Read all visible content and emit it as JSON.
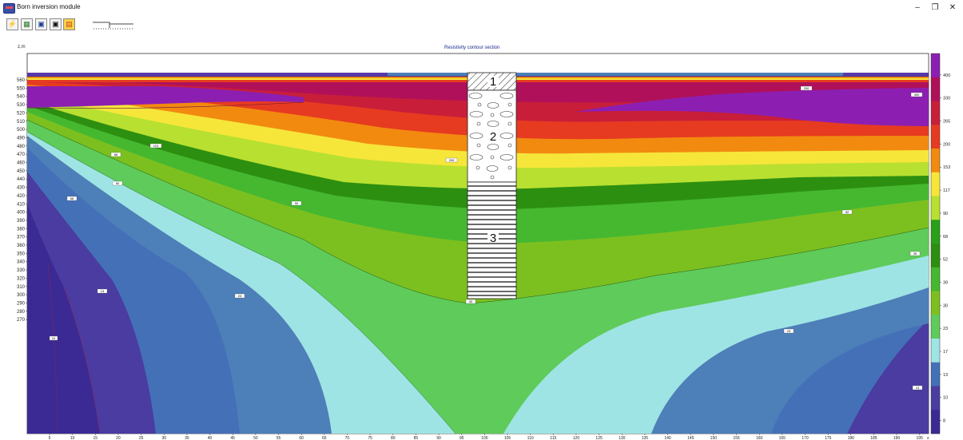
{
  "window": {
    "title": "Born inversion module",
    "icon": "app-icon",
    "controls": {
      "minimize": "–",
      "maximize": "❐",
      "close": "✕"
    }
  },
  "toolbar": {
    "buttons": [
      {
        "name": "run-inversion-button",
        "icon": "lightning-icon",
        "glyph": "⚡"
      },
      {
        "name": "table-button",
        "icon": "table-icon",
        "glyph": "▦"
      },
      {
        "name": "save-button",
        "icon": "disk-save-icon",
        "glyph": "▣"
      },
      {
        "name": "save-as-button",
        "icon": "disk-save-as-icon",
        "glyph": "▣"
      },
      {
        "name": "palette-button",
        "icon": "palette-icon",
        "glyph": "▤"
      }
    ]
  },
  "chart": {
    "title": "Resistivity contour section",
    "y_axis_label": "z,m",
    "y_ticks": [
      "560",
      "550",
      "540",
      "530",
      "520",
      "510",
      "500",
      "490",
      "480",
      "470",
      "460",
      "450",
      "440",
      "430",
      "420",
      "410",
      "400",
      "390",
      "380",
      "370",
      "360",
      "350",
      "340",
      "330",
      "320",
      "310",
      "300",
      "290",
      "280",
      "270"
    ],
    "x_ticks": [
      "5",
      "10",
      "15",
      "20",
      "25",
      "30",
      "35",
      "40",
      "45",
      "50",
      "55",
      "60",
      "65",
      "70",
      "75",
      "80",
      "85",
      "90",
      "95",
      "100",
      "105",
      "110",
      "115",
      "120",
      "125",
      "130",
      "135",
      "140",
      "145",
      "150",
      "155",
      "160",
      "165",
      "170",
      "175",
      "180",
      "185",
      "190",
      "195"
    ],
    "x_axis_label": "x",
    "colorbar_labels": [
      "400",
      "330",
      "265",
      "200",
      "153",
      "117",
      "90",
      "68",
      "52",
      "39",
      "30",
      "23",
      "17",
      "13",
      "10",
      "8"
    ],
    "colorbar_colors": [
      "#8c1fb2",
      "#b0105a",
      "#c81e3a",
      "#e63b20",
      "#f28a10",
      "#f6e63a",
      "#b8e030",
      "#28a018",
      "#2d8f10",
      "#45b830",
      "#7cc020",
      "#5ecb5a",
      "#9fe4e4",
      "#4470b8",
      "#4a3ca0",
      "#3b2a94"
    ],
    "contour_labels": [
      "200",
      "400",
      "110",
      "200",
      "68",
      "90",
      "90",
      "68",
      "23",
      "30",
      "13",
      "10",
      "39",
      "52",
      "23",
      "13"
    ],
    "borehole": {
      "layer_numbers": [
        "1",
        "2",
        "3"
      ]
    }
  }
}
